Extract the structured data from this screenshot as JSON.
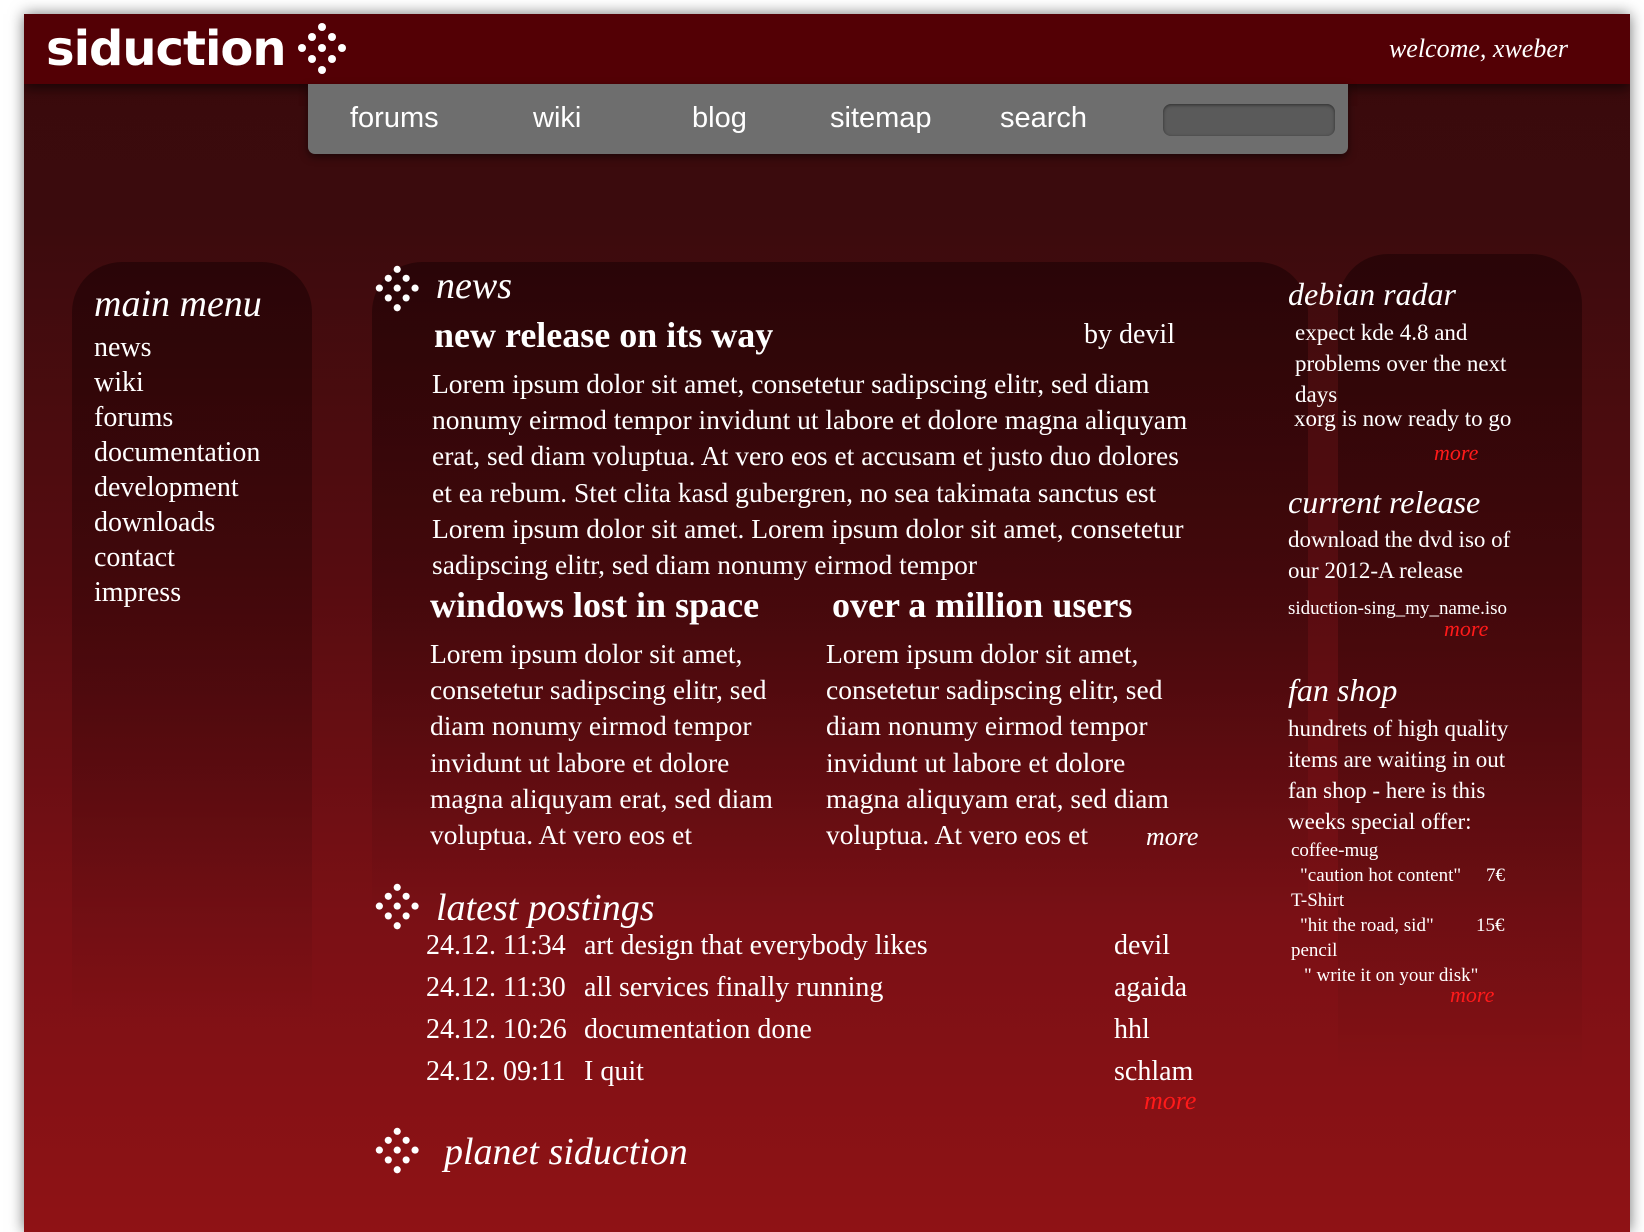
{
  "header": {
    "logo_text": "siduction",
    "welcome_text": "welcome, xweber",
    "colors": {
      "header_bar": "#530005",
      "page_top": "#3a0a0c",
      "page_bottom": "#8f1215",
      "nav_bar": "#6e6e6e",
      "more_link": "#ff1a1a"
    }
  },
  "nav": {
    "items": [
      {
        "label": "forums"
      },
      {
        "label": "wiki"
      },
      {
        "label": "blog"
      },
      {
        "label": "sitemap"
      },
      {
        "label": "search"
      }
    ],
    "search_value": ""
  },
  "main_menu": {
    "title": "main menu",
    "items": [
      "news",
      "wiki",
      "forums",
      "documentation",
      "development",
      "downloads",
      "contact",
      "impress"
    ]
  },
  "news": {
    "title": "news",
    "headline": "new release on its way",
    "byline": "by devil",
    "body": "Lorem ipsum dolor sit amet, consetetur sadipscing elitr, sed diam nonumy eirmod tempor invidunt ut labore et dolore magna aliquyam erat, sed diam voluptua. At vero eos et accusam et justo duo dolores et ea rebum. Stet clita kasd gubergren, no sea takimata sanctus est Lorem ipsum dolor sit amet. Lorem ipsum dolor sit amet, consetetur sadipscing elitr, sed diam nonumy eirmod tempor",
    "col1": {
      "headline": "windows lost in space",
      "body": "Lorem ipsum dolor sit amet, consetetur sadipscing elitr, sed diam nonumy eirmod tempor invidunt ut labore et dolore magna aliquyam erat, sed diam voluptua. At vero eos et"
    },
    "col2": {
      "headline": "over a million users",
      "body": "Lorem ipsum dolor sit amet, consetetur sadipscing elitr, sed diam nonumy eirmod tempor invidunt ut labore et dolore magna aliquyam erat, sed diam voluptua. At vero eos et"
    },
    "more": "more"
  },
  "postings": {
    "title": "latest postings",
    "rows": [
      {
        "time": "24.12. 11:34",
        "subject": "art design that everybody likes",
        "author": "devil"
      },
      {
        "time": "24.12. 11:30",
        "subject": "all services finally running",
        "author": "agaida"
      },
      {
        "time": "24.12. 10:26",
        "subject": "documentation done",
        "author": "hhl"
      },
      {
        "time": "24.12. 09:11",
        "subject": "I quit",
        "author": "schlam"
      }
    ],
    "more": "more"
  },
  "planet": {
    "title": "planet siduction"
  },
  "sidebar": {
    "radar": {
      "title": "debian radar",
      "item1": "expect kde 4.8 and problems over the next days",
      "item2": "xorg is now ready to go",
      "more": "more"
    },
    "release": {
      "title": "current release",
      "text": "download the dvd iso of our 2012-A release",
      "file": "siduction-sing_my_name.iso",
      "more": "more"
    },
    "shop": {
      "title": "fan shop",
      "text": "hundrets of high quality items are waiting in out fan shop - here is this weeks special offer:",
      "items": [
        {
          "name": "coffee-mug",
          "desc": "\"caution hot content\"",
          "price": "7€"
        },
        {
          "name": "T-Shirt",
          "desc": "\"hit the road, sid\"",
          "price": "15€"
        },
        {
          "name": "pencil",
          "desc": "\" write it on your disk\"",
          "price": ""
        }
      ],
      "more": "more"
    }
  }
}
